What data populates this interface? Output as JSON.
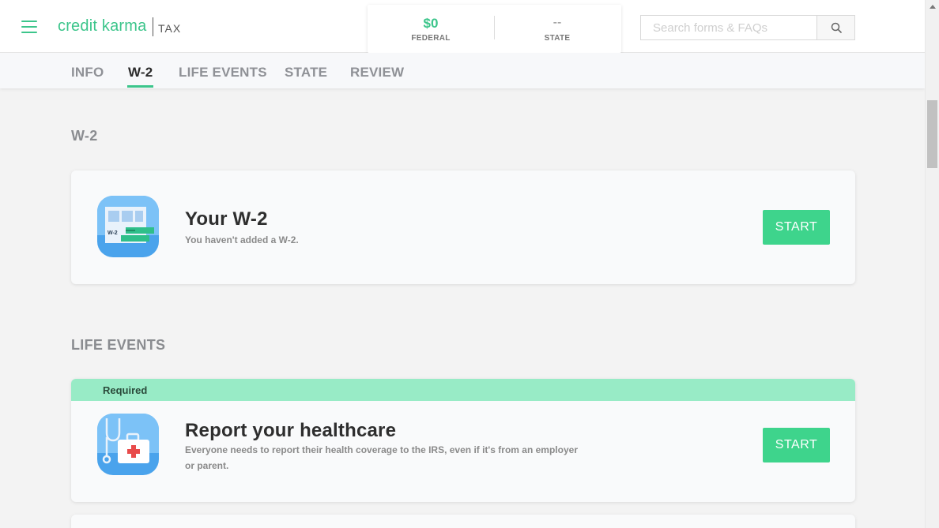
{
  "header": {
    "brand": "credit karma",
    "brand_suffix": "TAX",
    "federal_amount": "$0",
    "federal_label": "FEDERAL",
    "state_amount": "--",
    "state_label": "STATE",
    "search_placeholder": "Search forms & FAQs",
    "search_value": ""
  },
  "tabs": [
    {
      "label": "INFO",
      "active": false
    },
    {
      "label": "W-2",
      "active": true
    },
    {
      "label": "LIFE EVENTS",
      "active": false
    },
    {
      "label": "STATE",
      "active": false
    },
    {
      "label": "REVIEW",
      "active": false
    }
  ],
  "sections": {
    "w2": {
      "title": "W-2",
      "card": {
        "icon": "w2-form-icon",
        "icon_text": "W-2",
        "title": "Your W-2",
        "description": "You haven't added a W-2.",
        "button": "START"
      }
    },
    "life_events": {
      "title": "LIFE EVENTS",
      "card": {
        "badge": "Required",
        "icon": "healthcare-icon",
        "title": "Report your healthcare",
        "description_line1": "Everyone needs to report their health coverage to the IRS, even if it's from an employer",
        "description_line2": "or parent.",
        "button": "START"
      }
    }
  },
  "colors": {
    "brand_green": "#3cc58b",
    "button_green": "#3ed48c",
    "required_banner": "#98ebc6"
  }
}
